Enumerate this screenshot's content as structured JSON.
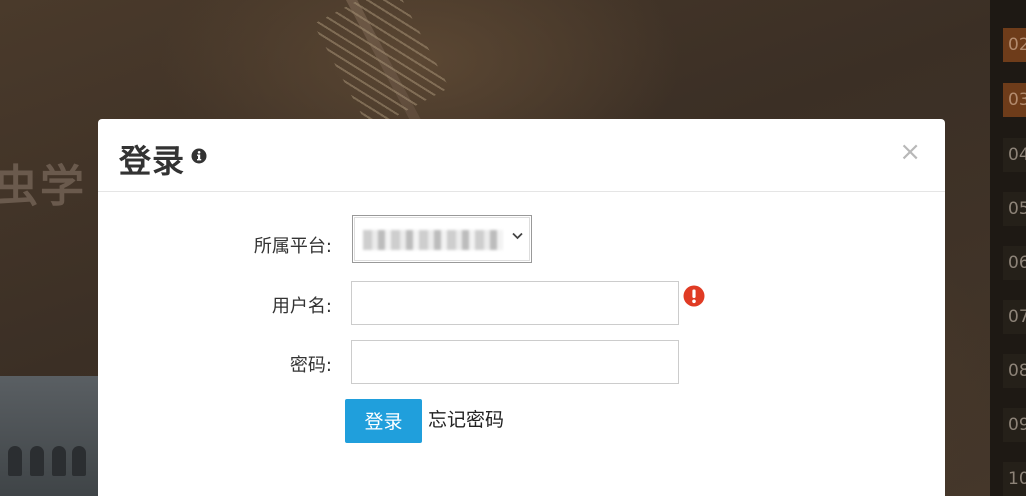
{
  "background": {
    "heading_fragment": "虫学",
    "date_list": [
      "02",
      "03",
      "04",
      "05",
      "06",
      "07",
      "08",
      "09",
      "10"
    ]
  },
  "modal": {
    "title": "登录",
    "title_icon": "info-circle-icon",
    "close_symbol": "×",
    "platform": {
      "label": "所属平台:",
      "value": ""
    },
    "username": {
      "label": "用户名:",
      "value": "",
      "error_icon": "exclamation-circle-icon",
      "error_color": "#e03b24"
    },
    "password": {
      "label": "密码:",
      "value": ""
    },
    "login_button": "登录",
    "forgot_password": "忘记密码",
    "accent_color": "#209fdc"
  }
}
